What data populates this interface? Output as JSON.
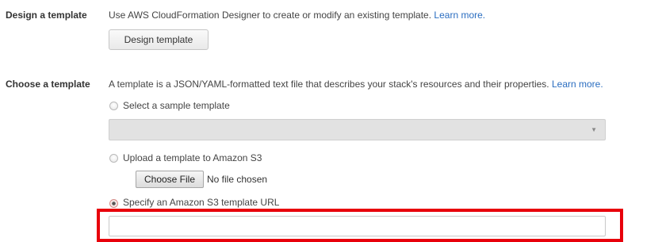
{
  "design_section": {
    "label": "Design a template",
    "description": "Use AWS CloudFormation Designer to create or modify an existing template.",
    "learn_more": "Learn more.",
    "button_label": "Design template"
  },
  "choose_section": {
    "label": "Choose a template",
    "description": "A template is a JSON/YAML-formatted text file that describes your stack's resources and their properties.",
    "learn_more": "Learn more.",
    "options": {
      "sample": {
        "label": "Select a sample template",
        "selected_value": "",
        "checked": false
      },
      "upload": {
        "label": "Upload a template to Amazon S3",
        "file_button_label": "Choose File",
        "file_status": "No file chosen",
        "checked": false
      },
      "url": {
        "label": "Specify an Amazon S3 template URL",
        "value": "",
        "checked": true
      }
    }
  },
  "colors": {
    "link": "#2a6dc0",
    "highlight_border": "#e8000b",
    "select_background": "#e2e2e2"
  },
  "icons": {
    "dropdown": "triangle-down"
  }
}
